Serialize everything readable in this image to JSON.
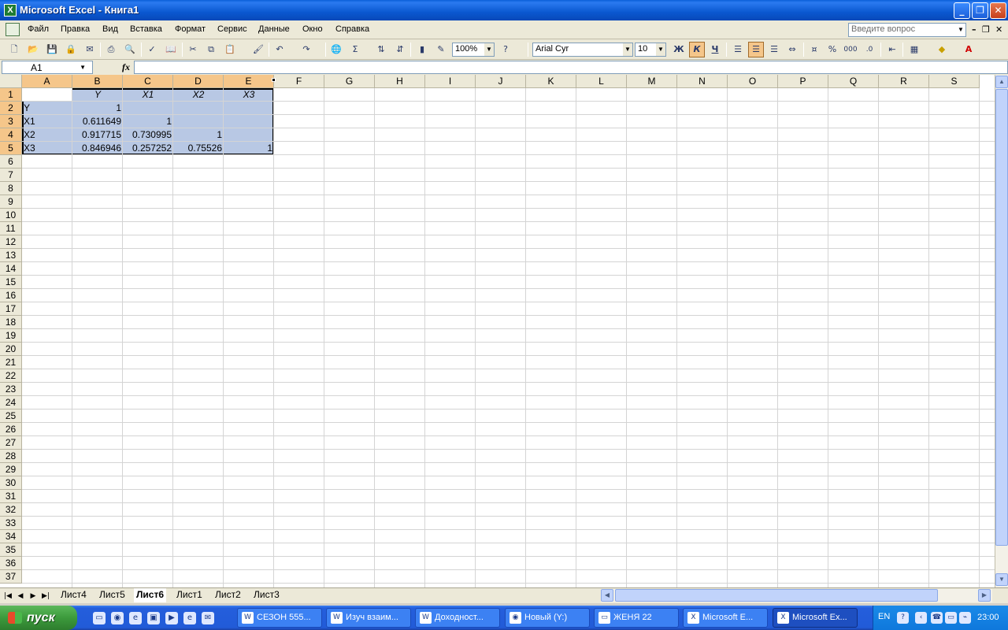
{
  "window": {
    "title": "Microsoft Excel - Книга1",
    "app_icon": "excel-icon"
  },
  "menu": {
    "items": [
      "Файл",
      "Правка",
      "Вид",
      "Вставка",
      "Формат",
      "Сервис",
      "Данные",
      "Окно",
      "Справка"
    ],
    "ask_placeholder": "Введите вопрос"
  },
  "toolbar": {
    "zoom": "100%",
    "font": "Arial Cyr",
    "font_size": "10",
    "bold": "Ж",
    "italic": "К",
    "underline": "Ч",
    "percent": "%",
    "thousands": "000"
  },
  "formula_bar": {
    "name_box": "A1",
    "fx": "fx",
    "value": ""
  },
  "columns": [
    "A",
    "B",
    "C",
    "D",
    "E",
    "F",
    "G",
    "H",
    "I",
    "J",
    "K",
    "L",
    "M",
    "N",
    "O",
    "P",
    "Q",
    "R",
    "S"
  ],
  "rows": [
    "1",
    "2",
    "3",
    "4",
    "5",
    "6",
    "7",
    "8",
    "9",
    "10",
    "11",
    "12",
    "13",
    "14",
    "15",
    "16",
    "17",
    "18",
    "19",
    "20",
    "21",
    "22",
    "23",
    "24",
    "25",
    "26",
    "27",
    "28",
    "29",
    "30",
    "31",
    "32",
    "33",
    "34",
    "35",
    "36",
    "37"
  ],
  "cells": {
    "B1": "Y",
    "C1": "X1",
    "D1": "X2",
    "E1": "X3",
    "A2": "Y",
    "B2": "1",
    "A3": "X1",
    "B3": "0.611649",
    "C3": "1",
    "A4": "X2",
    "B4": "0.917715",
    "C4": "0.730995",
    "D4": "1",
    "A5": "X3",
    "B5": "0.846946",
    "C5": "0.257252",
    "D5": "0.75526",
    "E5": "1"
  },
  "sheets": {
    "tabs": [
      "Лист4",
      "Лист5",
      "Лист6",
      "Лист1",
      "Лист2",
      "Лист3"
    ],
    "active": "Лист6"
  },
  "taskbar": {
    "start": "пуск",
    "tasks": [
      "СЕЗОН 555...",
      "Изуч взаим...",
      "Доходност...",
      "Новый (Y:)",
      "ЖЕНЯ 22",
      "Microsoft E...",
      "Microsoft Ex..."
    ],
    "active_task": "Microsoft Ex...",
    "lang": "EN",
    "clock": "23:00"
  },
  "colors": {
    "title_bar": "#0a58d0",
    "selection": "#b8c8e4",
    "header_selected": "#f5c68a",
    "taskbar": "#245edc",
    "start": "#3c9a3c"
  }
}
